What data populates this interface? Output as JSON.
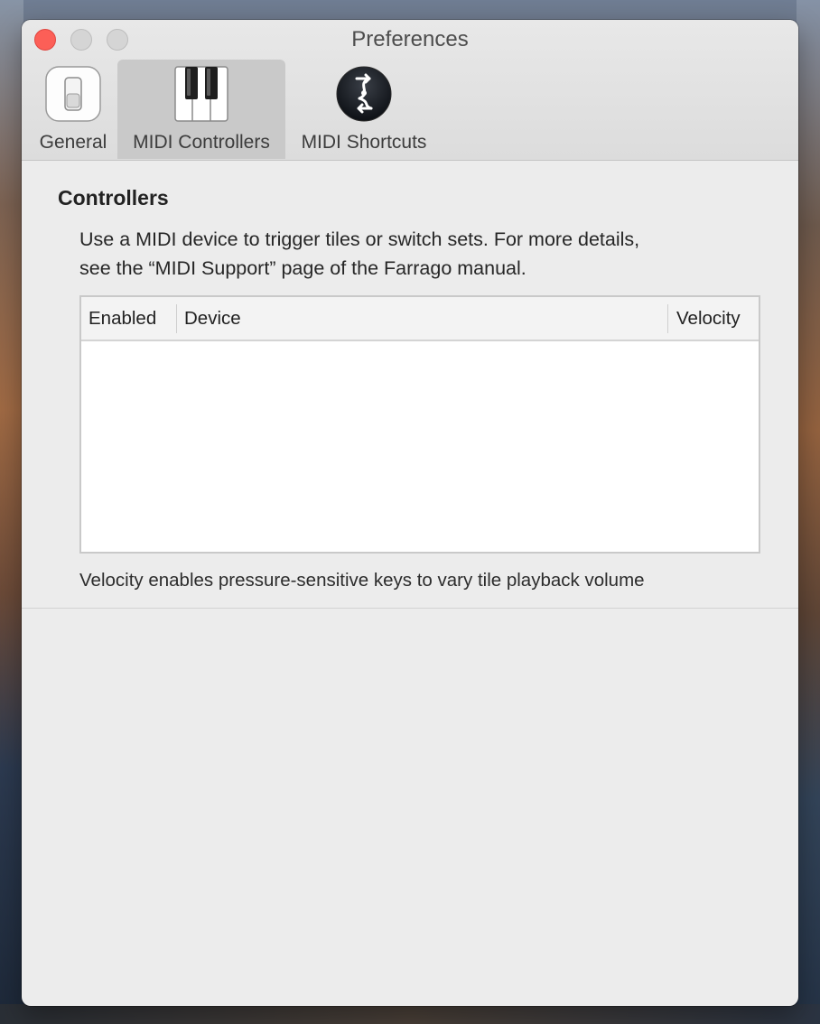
{
  "window": {
    "title": "Preferences"
  },
  "toolbar": {
    "tabs": [
      {
        "label": "General",
        "icon": "toggle-switch-icon",
        "selected": false
      },
      {
        "label": "MIDI Controllers",
        "icon": "piano-keys-icon",
        "selected": true
      },
      {
        "label": "MIDI Shortcuts",
        "icon": "midi-shortcut-icon",
        "selected": false
      }
    ]
  },
  "controllers": {
    "heading": "Controllers",
    "description_line1": "Use a MIDI device to trigger tiles or switch sets. For more details,",
    "description_line2": "see the “MIDI Support” page of the Farrago manual.",
    "table": {
      "columns": [
        "Enabled",
        "Device",
        "Velocity"
      ],
      "rows": []
    },
    "footnote": "Velocity enables pressure-sensitive keys to vary tile playback volume"
  },
  "colors": {
    "close": "#fc5f57",
    "selected_tab_bg": "#c9c9c9",
    "window_bg": "#ececec"
  }
}
